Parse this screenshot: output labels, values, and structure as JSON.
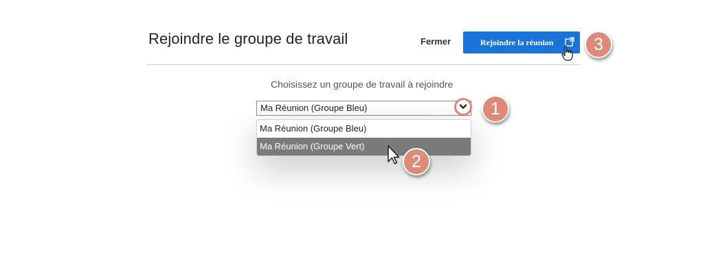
{
  "dialog": {
    "title": "Rejoindre le groupe de travail",
    "close_label": "Fermer",
    "join_label": "Rejoindre la réunion",
    "prompt": "Choisissez un groupe de travail à rejoindre"
  },
  "select": {
    "value": "Ma Réunion (Groupe Bleu)",
    "options": [
      "Ma Réunion (Groupe Bleu)",
      "Ma Réunion (Groupe Vert)"
    ],
    "hovered_option_index": 1
  },
  "annotations": {
    "step1": "1",
    "step2": "2",
    "step3": "3"
  },
  "icons": {
    "external": "external-link-icon",
    "chevron": "chevron-down-icon",
    "hand_cursor": "hand-pointer-icon",
    "arrow_cursor": "arrow-pointer-icon"
  },
  "colors": {
    "primary": "#1a73d8",
    "badge": "#dd8a78",
    "hover_option": "#7a7a7a"
  }
}
